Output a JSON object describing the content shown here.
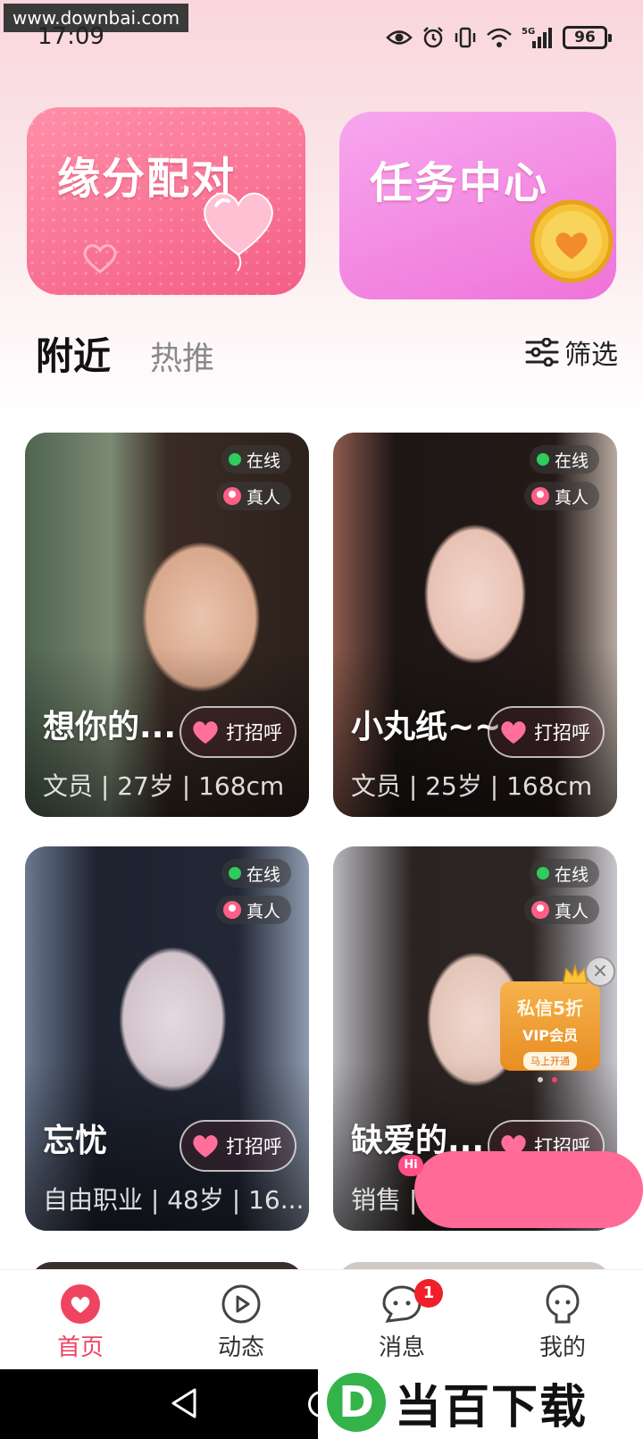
{
  "watermark": "www.downbai.com",
  "status": {
    "time": "17:09",
    "battery": "96",
    "network": "5G"
  },
  "banners": {
    "pair_title": "缘分配对",
    "task_title": "任务中心"
  },
  "tabs": {
    "nearby": "附近",
    "hot": "热推",
    "filter": "筛选"
  },
  "labels": {
    "online": "在线",
    "real": "真人",
    "greet": "打招呼"
  },
  "cards": [
    {
      "name": "想你的...",
      "info": "文员 | 27岁 | 168cm",
      "online": true,
      "real": true
    },
    {
      "name": "小丸纸~~",
      "info": "文员 | 25岁 | 168cm",
      "online": true,
      "real": true
    },
    {
      "name": "忘忧",
      "info": "自由职业 | 48岁 | 16...",
      "online": true,
      "real": true
    },
    {
      "name": "缺爱的...",
      "info": "销售 |",
      "online": true,
      "real": true
    }
  ],
  "vip_popup": {
    "line1": "私信5折",
    "line2": "VIP会员",
    "line3": "马上开通",
    "close": "×"
  },
  "hi_bubble": "Hi",
  "bottom_nav": {
    "home": "首页",
    "feed": "动态",
    "messages": "消息",
    "me": "我的",
    "messages_badge": "1"
  },
  "logo": {
    "letter": "D",
    "text": "当百下载"
  },
  "colors": {
    "accent": "#ee4461",
    "pink_banner": "#f45e86",
    "purple_banner": "#ef73d9",
    "online_dot": "#2ecc5a",
    "float_bar": "#ff6a97"
  }
}
